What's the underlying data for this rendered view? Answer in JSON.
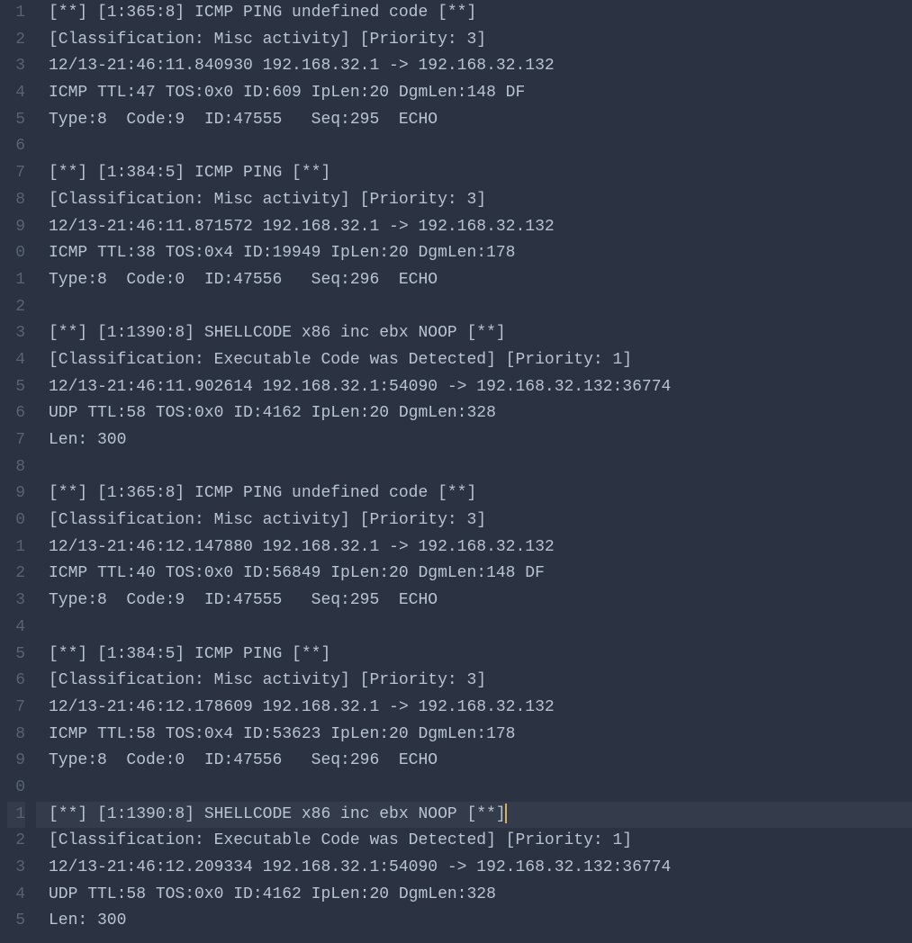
{
  "editor": {
    "currentLine": 31,
    "lines": [
      {
        "num": "1",
        "text": "[**] [1:365:8] ICMP PING undefined code [**]"
      },
      {
        "num": "2",
        "text": "[Classification: Misc activity] [Priority: 3]"
      },
      {
        "num": "3",
        "text": "12/13-21:46:11.840930 192.168.32.1 -> 192.168.32.132"
      },
      {
        "num": "4",
        "text": "ICMP TTL:47 TOS:0x0 ID:609 IpLen:20 DgmLen:148 DF"
      },
      {
        "num": "5",
        "text": "Type:8  Code:9  ID:47555   Seq:295  ECHO"
      },
      {
        "num": "6",
        "text": ""
      },
      {
        "num": "7",
        "text": "[**] [1:384:5] ICMP PING [**]"
      },
      {
        "num": "8",
        "text": "[Classification: Misc activity] [Priority: 3]"
      },
      {
        "num": "9",
        "text": "12/13-21:46:11.871572 192.168.32.1 -> 192.168.32.132"
      },
      {
        "num": "0",
        "text": "ICMP TTL:38 TOS:0x4 ID:19949 IpLen:20 DgmLen:178"
      },
      {
        "num": "1",
        "text": "Type:8  Code:0  ID:47556   Seq:296  ECHO"
      },
      {
        "num": "2",
        "text": ""
      },
      {
        "num": "3",
        "text": "[**] [1:1390:8] SHELLCODE x86 inc ebx NOOP [**]"
      },
      {
        "num": "4",
        "text": "[Classification: Executable Code was Detected] [Priority: 1]"
      },
      {
        "num": "5",
        "text": "12/13-21:46:11.902614 192.168.32.1:54090 -> 192.168.32.132:36774"
      },
      {
        "num": "6",
        "text": "UDP TTL:58 TOS:0x0 ID:4162 IpLen:20 DgmLen:328"
      },
      {
        "num": "7",
        "text": "Len: 300"
      },
      {
        "num": "8",
        "text": ""
      },
      {
        "num": "9",
        "text": "[**] [1:365:8] ICMP PING undefined code [**]"
      },
      {
        "num": "0",
        "text": "[Classification: Misc activity] [Priority: 3]"
      },
      {
        "num": "1",
        "text": "12/13-21:46:12.147880 192.168.32.1 -> 192.168.32.132"
      },
      {
        "num": "2",
        "text": "ICMP TTL:40 TOS:0x0 ID:56849 IpLen:20 DgmLen:148 DF"
      },
      {
        "num": "3",
        "text": "Type:8  Code:9  ID:47555   Seq:295  ECHO"
      },
      {
        "num": "4",
        "text": ""
      },
      {
        "num": "5",
        "text": "[**] [1:384:5] ICMP PING [**]"
      },
      {
        "num": "6",
        "text": "[Classification: Misc activity] [Priority: 3]"
      },
      {
        "num": "7",
        "text": "12/13-21:46:12.178609 192.168.32.1 -> 192.168.32.132"
      },
      {
        "num": "8",
        "text": "ICMP TTL:58 TOS:0x4 ID:53623 IpLen:20 DgmLen:178"
      },
      {
        "num": "9",
        "text": "Type:8  Code:0  ID:47556   Seq:296  ECHO"
      },
      {
        "num": "0",
        "text": ""
      },
      {
        "num": "1",
        "text": "[**] [1:1390:8] SHELLCODE x86 inc ebx NOOP [**]"
      },
      {
        "num": "2",
        "text": "[Classification: Executable Code was Detected] [Priority: 1]"
      },
      {
        "num": "3",
        "text": "12/13-21:46:12.209334 192.168.32.1:54090 -> 192.168.32.132:36774"
      },
      {
        "num": "4",
        "text": "UDP TTL:58 TOS:0x0 ID:4162 IpLen:20 DgmLen:328"
      },
      {
        "num": "5",
        "text": "Len: 300"
      }
    ]
  }
}
